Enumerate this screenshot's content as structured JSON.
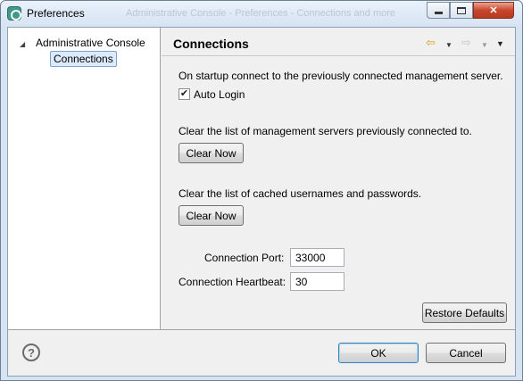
{
  "window": {
    "title": "Preferences",
    "ghost_title": "Administrative Console - Preferences - Connections and more"
  },
  "tree": {
    "root_label": "Administrative Console",
    "child_label": "Connections"
  },
  "panel": {
    "title": "Connections",
    "startup_text": "On startup connect to the previously connected management server.",
    "auto_login_label": "Auto Login",
    "auto_login_checked": true,
    "clear_servers_text": "Clear the list of management servers previously connected to.",
    "clear_servers_button": "Clear Now",
    "clear_credentials_text": "Clear the list of cached usernames and passwords.",
    "clear_credentials_button": "Clear Now",
    "port_label": "Connection Port:",
    "port_value": "33000",
    "heartbeat_label": "Connection Heartbeat:",
    "heartbeat_value": "30",
    "restore_defaults_button": "Restore Defaults"
  },
  "footer": {
    "ok_label": "OK",
    "cancel_label": "Cancel"
  },
  "icons": {
    "back": "arrow-left-icon",
    "forward": "arrow-right-icon",
    "help": "help-icon"
  },
  "colors": {
    "selection_bg": "#dceafb",
    "close_button": "#c9462c",
    "back_arrow": "#d7a323"
  }
}
